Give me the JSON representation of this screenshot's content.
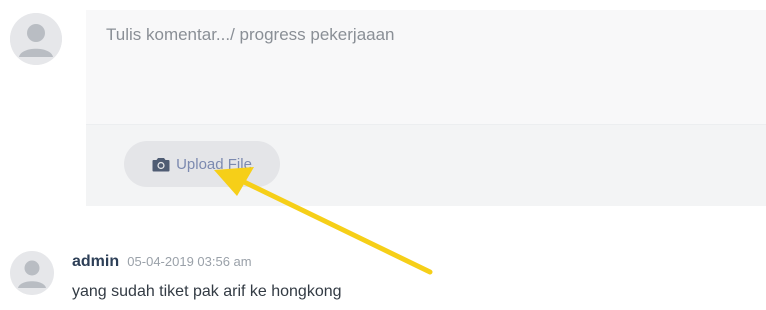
{
  "compose": {
    "placeholder": "Tulis komentar.../ progress pekerjaaan",
    "value": "",
    "upload_icon": "camera-icon",
    "upload_label": "Upload File"
  },
  "comments": [
    {
      "author": "admin",
      "date": "05-04-2019 03:56 am",
      "text": "yang sudah tiket pak arif ke hongkong"
    }
  ],
  "colors": {
    "annotation_arrow": "#f6cf18",
    "button_text": "#7c8ab0",
    "author": "#2d3f57"
  }
}
